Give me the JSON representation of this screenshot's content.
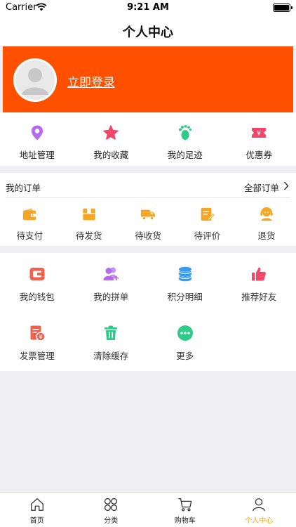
{
  "status_bar": {
    "carrier": "Carrier",
    "time": "9:21 AM"
  },
  "nav": {
    "title": "个人中心"
  },
  "profile": {
    "login_label": "立即登录"
  },
  "quick_links": [
    {
      "label": "地址管理",
      "icon": "location-pin-icon",
      "color": "#b36bf0"
    },
    {
      "label": "我的收藏",
      "icon": "star-icon",
      "color": "#f0476b"
    },
    {
      "label": "我的足迹",
      "icon": "footprint-icon",
      "color": "#2ecb8a"
    },
    {
      "label": "优惠券",
      "icon": "coupon-icon",
      "color": "#f0476b"
    }
  ],
  "orders": {
    "title": "我的订单",
    "all_label": "全部订单",
    "items": [
      {
        "label": "待支付",
        "icon": "wallet-icon"
      },
      {
        "label": "待发货",
        "icon": "package-icon"
      },
      {
        "label": "待收货",
        "icon": "truck-icon"
      },
      {
        "label": "待评价",
        "icon": "review-icon"
      },
      {
        "label": "退货",
        "icon": "customer-service-icon"
      }
    ],
    "icon_color": "#f5a623"
  },
  "services": [
    {
      "label": "我的钱包",
      "icon": "wallet-icon",
      "color": "#f0604d"
    },
    {
      "label": "我的拼单",
      "icon": "group-users-icon",
      "color": "#b36bf0"
    },
    {
      "label": "积分明细",
      "icon": "database-icon",
      "color": "#3a9be8"
    },
    {
      "label": "推荐好友",
      "icon": "thumbs-up-icon",
      "color": "#f0476b"
    },
    {
      "label": "发票管理",
      "icon": "invoice-icon",
      "color": "#f0604d"
    },
    {
      "label": "清除缓存",
      "icon": "trash-icon",
      "color": "#2ecb8a"
    },
    {
      "label": "更多",
      "icon": "more-icon",
      "color": "#2ecb8a"
    }
  ],
  "tabbar": {
    "active": "个人中心",
    "active_color": "#f5a623",
    "items": [
      {
        "label": "首页",
        "icon": "home-icon"
      },
      {
        "label": "分类",
        "icon": "category-icon"
      },
      {
        "label": "购物车",
        "icon": "cart-icon"
      },
      {
        "label": "个人中心",
        "icon": "user-icon"
      }
    ]
  },
  "colors": {
    "brand": "#ff5000",
    "background": "#efeff4"
  }
}
